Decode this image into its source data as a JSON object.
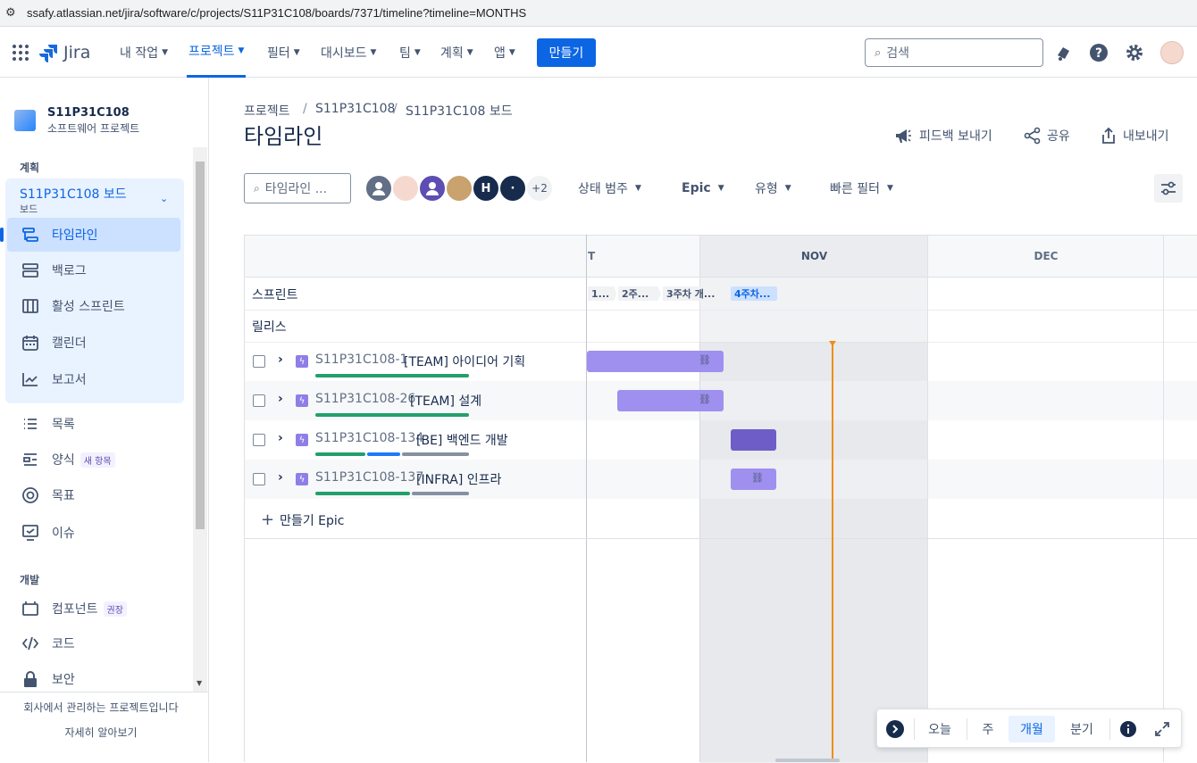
{
  "browser": {
    "url": "ssafy.atlassian.net/jira/software/c/projects/S11P31C108/boards/7371/timeline?timeline=MONTHS"
  },
  "topnav": {
    "logo": "Jira",
    "items": [
      "내 작업",
      "프로젝트",
      "필터",
      "대시보드",
      "팀",
      "계획",
      "앱"
    ],
    "create": "만들기",
    "search_placeholder": "검색"
  },
  "sidebar": {
    "project_name": "S11P31C108",
    "project_type": "소프트웨어 프로젝트",
    "section_plan": "계획",
    "board_name": "S11P31C108 보드",
    "board_sub": "보드",
    "plan_items": [
      "타임라인",
      "백로그",
      "활성 스프린트",
      "캘린더",
      "보고서"
    ],
    "other_items": [
      "목록",
      "양식",
      "목표",
      "이슈"
    ],
    "form_badge": "새 항목",
    "section_dev": "개발",
    "dev_items": [
      "컴포넌트",
      "코드",
      "보안"
    ],
    "component_badge": "권장",
    "footer_text": "회사에서 관리하는 프로젝트입니다",
    "footer_link": "자세히 알아보기"
  },
  "breadcrumb": [
    "프로젝트",
    "S11P31C108",
    "S11P31C108 보드"
  ],
  "page_title": "타임라인",
  "actions": {
    "feedback": "피드백 보내기",
    "share": "공유",
    "export": "내보내기"
  },
  "toolbar": {
    "search_placeholder": "타임라인 ...",
    "avatar_letters": [
      "H",
      "·"
    ],
    "more_avatars": "+2",
    "filters": [
      "상태 범주",
      "Epic",
      "유형",
      "빠른 필터"
    ]
  },
  "timeline": {
    "months": [
      "T",
      "NOV",
      "DEC"
    ],
    "row_sprint": "스프린트",
    "row_release": "릴리스",
    "sprints": [
      "1...",
      "2주...",
      "3주차 개...",
      "4주차..."
    ],
    "create_epic": "만들기 Epic",
    "epics": [
      {
        "key": "S11P31C108-1",
        "summary": "[TEAM] 아이디어 기획"
      },
      {
        "key": "S11P31C108-26",
        "summary": "[TEAM] 설계"
      },
      {
        "key": "S11P31C108-134",
        "summary": "[BE] 백엔드 개발"
      },
      {
        "key": "S11P31C108-137",
        "summary": "[INFRA] 인프라"
      }
    ]
  },
  "bottom": {
    "today": "오늘",
    "week": "주",
    "month": "개월",
    "quarter": "분기"
  },
  "colors": {
    "accent": "#0c66e4",
    "epic_bar": "#9f8fef",
    "epic_bar_dark": "#6e5dc6",
    "today_line": "#f18d13",
    "done": "#22a06b",
    "in_progress": "#1d7afc",
    "todo": "#8590a2"
  }
}
